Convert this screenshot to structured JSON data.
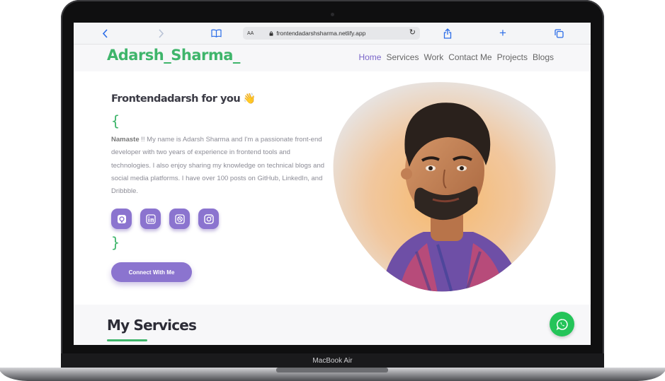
{
  "device": {
    "label": "MacBook Air"
  },
  "browser": {
    "url": "frontendadarshsharma.netlify.app",
    "text_size_label": "AA",
    "icons": [
      "back-icon",
      "forward-icon",
      "book-icon",
      "lock-icon",
      "reload-icon",
      "share-icon",
      "plus-icon",
      "tabs-icon"
    ],
    "accent": "#2b6de8"
  },
  "header": {
    "logo": "Adarsh_Sharma_",
    "nav": [
      "Home",
      "Services",
      "Work",
      "Contact Me",
      "Projects",
      "Blogs"
    ],
    "active_nav": "Home"
  },
  "hero": {
    "greeting": "Frontendadarsh for you",
    "greeting_emoji": "👋",
    "open_brace": "{",
    "close_brace": "}",
    "bio_strong": "Namaste",
    "bio": " !! My name is Adarsh Sharma and I'm a passionate front-end developer with two years of experience in frontend tools and technologies. I also enjoy sharing my knowledge on technical blogs and social media platforms. I have over 100 posts on GitHub, LinkedIn, and Dribbble.",
    "socials": [
      "github-icon",
      "linkedin-icon",
      "dribbble-icon",
      "instagram-icon"
    ],
    "cta": "Connect With Me"
  },
  "services": {
    "title": "My Services"
  },
  "colors": {
    "brand_green": "#3fb56b",
    "brand_purple": "#8b74cf",
    "whatsapp_green": "#24c459"
  }
}
